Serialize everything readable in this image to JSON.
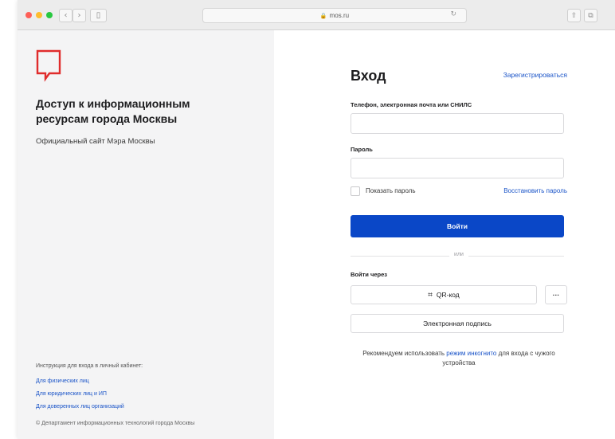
{
  "browser": {
    "url": "mos.ru",
    "lock_icon": "🔒",
    "reload_icon": "↻",
    "back_icon": "‹",
    "forward_icon": "›",
    "sidebar_icon": "▯",
    "share_icon": "⇧",
    "tabs_icon": "⧉"
  },
  "colors": {
    "brand_red": "#e02c2c",
    "accent_blue": "#0a47c7",
    "link_blue": "#1a54c8"
  },
  "left": {
    "logo": "mos-logo",
    "title": "Доступ к информационным ресурсам города Москвы",
    "subtitle": "Официальный сайт Мэра Москвы",
    "instructions_label": "Инструкция для входа в личный кабинет:",
    "links": [
      "Для физических лиц",
      "Для юридических лиц и ИП",
      "Для доверенных лиц организаций"
    ],
    "copyright": "© Департамент информационных технологий города Москвы"
  },
  "form": {
    "heading": "Вход",
    "register_link": "Зарегистрироваться",
    "login_label": "Телефон, электронная почта или СНИЛС",
    "login_value": "",
    "password_label": "Пароль",
    "password_value": "",
    "show_password_label": "Показать пароль",
    "restore_link": "Восстановить пароль",
    "submit_label": "Войти",
    "or_label": "или",
    "login_via_label": "Войти через",
    "qr_label": "QR-код",
    "qr_icon": "⌗",
    "more_label": "···",
    "signature_label": "Электронная подпись",
    "recommend_prefix": "Рекомендуем использовать ",
    "recommend_link": "режим инкогнито",
    "recommend_suffix": " для входа с чужого устройства"
  }
}
